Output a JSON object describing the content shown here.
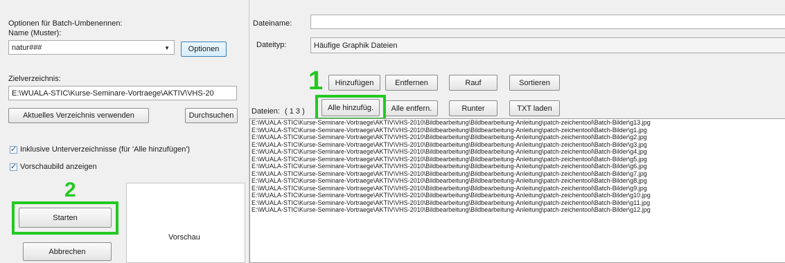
{
  "left": {
    "options_heading": "Optionen für Batch-Umbenennen:",
    "name_label": "Name (Muster):",
    "name_value": "natur###",
    "options_button": "Optionen",
    "target_dir_label": "Zielverzeichnis:",
    "target_dir_value": "E:\\WUALA-STIC\\Kurse-Seminare-Vortraege\\AKTIV\\VHS-20",
    "use_current_dir_button": "Aktuelles Verzeichnis verwenden",
    "browse_button": "Durchsuchen",
    "include_subdirs_label": "Inklusive Unterverzeichnisse (für 'Alle hinzufügen')",
    "show_preview_label": "Vorschaubild anzeigen",
    "start_button": "Starten",
    "cancel_button": "Abbrechen",
    "preview_label": "Vorschau"
  },
  "right": {
    "filename_label": "Dateiname:",
    "filename_value": "",
    "filetype_label": "Dateityp:",
    "filetype_value": "Häufige Graphik Dateien",
    "files_label": "Dateien:",
    "files_count": "( 1 3 )",
    "buttons": {
      "add": "Hinzufügen",
      "remove": "Entfernen",
      "up": "Rauf",
      "sort": "Sortieren",
      "add_all": "Alle hinzufüg.",
      "remove_all": "Alle entfern.",
      "down": "Runter",
      "load_txt": "TXT laden"
    },
    "files": [
      "E:\\WUALA-STIC\\Kurse-Seminare-Vortraege\\AKTIV\\VHS-2010\\Bildbearbeitung\\Bildbearbeitung-Anleitung\\patch-zeichentool\\Batch-Bilder\\g13.jpg",
      "E:\\WUALA-STIC\\Kurse-Seminare-Vortraege\\AKTIV\\VHS-2010\\Bildbearbeitung\\Bildbearbeitung-Anleitung\\patch-zeichentool\\Batch-Bilder\\g1.jpg",
      "E:\\WUALA-STIC\\Kurse-Seminare-Vortraege\\AKTIV\\VHS-2010\\Bildbearbeitung\\Bildbearbeitung-Anleitung\\patch-zeichentool\\Batch-Bilder\\g2.jpg",
      "E:\\WUALA-STIC\\Kurse-Seminare-Vortraege\\AKTIV\\VHS-2010\\Bildbearbeitung\\Bildbearbeitung-Anleitung\\patch-zeichentool\\Batch-Bilder\\g3.jpg",
      "E:\\WUALA-STIC\\Kurse-Seminare-Vortraege\\AKTIV\\VHS-2010\\Bildbearbeitung\\Bildbearbeitung-Anleitung\\patch-zeichentool\\Batch-Bilder\\g4.jpg",
      "E:\\WUALA-STIC\\Kurse-Seminare-Vortraege\\AKTIV\\VHS-2010\\Bildbearbeitung\\Bildbearbeitung-Anleitung\\patch-zeichentool\\Batch-Bilder\\g5.jpg",
      "E:\\WUALA-STIC\\Kurse-Seminare-Vortraege\\AKTIV\\VHS-2010\\Bildbearbeitung\\Bildbearbeitung-Anleitung\\patch-zeichentool\\Batch-Bilder\\g6.jpg",
      "E:\\WUALA-STIC\\Kurse-Seminare-Vortraege\\AKTIV\\VHS-2010\\Bildbearbeitung\\Bildbearbeitung-Anleitung\\patch-zeichentool\\Batch-Bilder\\g7.jpg",
      "E:\\WUALA-STIC\\Kurse-Seminare-Vortraege\\AKTIV\\VHS-2010\\Bildbearbeitung\\Bildbearbeitung-Anleitung\\patch-zeichentool\\Batch-Bilder\\g8.jpg",
      "E:\\WUALA-STIC\\Kurse-Seminare-Vortraege\\AKTIV\\VHS-2010\\Bildbearbeitung\\Bildbearbeitung-Anleitung\\patch-zeichentool\\Batch-Bilder\\g9.jpg",
      "E:\\WUALA-STIC\\Kurse-Seminare-Vortraege\\AKTIV\\VHS-2010\\Bildbearbeitung\\Bildbearbeitung-Anleitung\\patch-zeichentool\\Batch-Bilder\\g10.jpg",
      "E:\\WUALA-STIC\\Kurse-Seminare-Vortraege\\AKTIV\\VHS-2010\\Bildbearbeitung\\Bildbearbeitung-Anleitung\\patch-zeichentool\\Batch-Bilder\\g11.jpg",
      "E:\\WUALA-STIC\\Kurse-Seminare-Vortraege\\AKTIV\\VHS-2010\\Bildbearbeitung\\Bildbearbeitung-Anleitung\\patch-zeichentool\\Batch-Bilder\\g12.jpg"
    ]
  },
  "annotations": {
    "step1": "1",
    "step2": "2",
    "highlight_color": "#22c922"
  },
  "icons": {
    "combo_arrow": "chevron-down-icon",
    "checkbox": "checkmark-icon"
  }
}
